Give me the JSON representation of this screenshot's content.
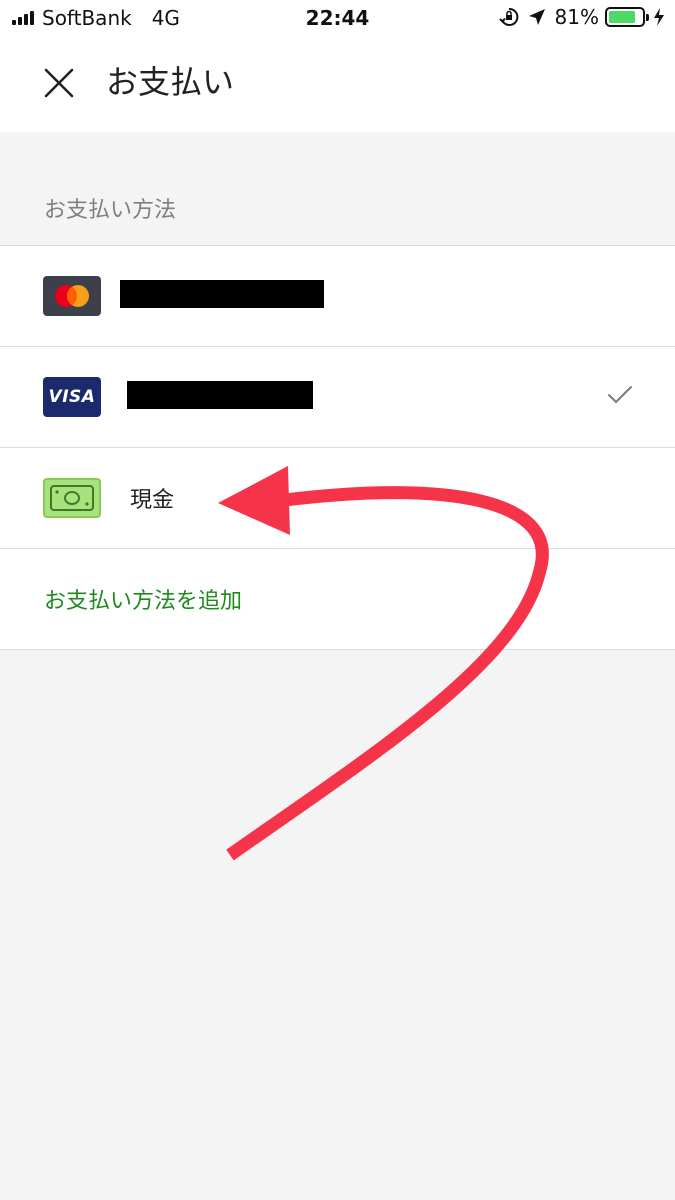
{
  "status_bar": {
    "carrier": "SoftBank",
    "network": "4G",
    "time": "22:44",
    "battery_percent": "81%",
    "battery_level": 0.81,
    "battery_color": "#4cd964",
    "icons": [
      "signal-icon",
      "orientation-lock-icon",
      "location-icon",
      "battery-icon",
      "charging-icon"
    ]
  },
  "header": {
    "title": "お支払い",
    "close_icon": "close-icon"
  },
  "section": {
    "label": "お支払い方法"
  },
  "payment_methods": [
    {
      "type": "mastercard",
      "icon": "mastercard-icon",
      "label_redacted": true,
      "selected": false
    },
    {
      "type": "visa",
      "icon": "visa-icon",
      "brand_text": "VISA",
      "label_redacted": true,
      "selected": true
    },
    {
      "type": "cash",
      "icon": "cash-icon",
      "label": "現金",
      "selected": false
    }
  ],
  "add_method": {
    "label": "お支払い方法を追加",
    "color": "#1e8a1e"
  },
  "annotation": {
    "arrow_color": "#f5344a"
  }
}
